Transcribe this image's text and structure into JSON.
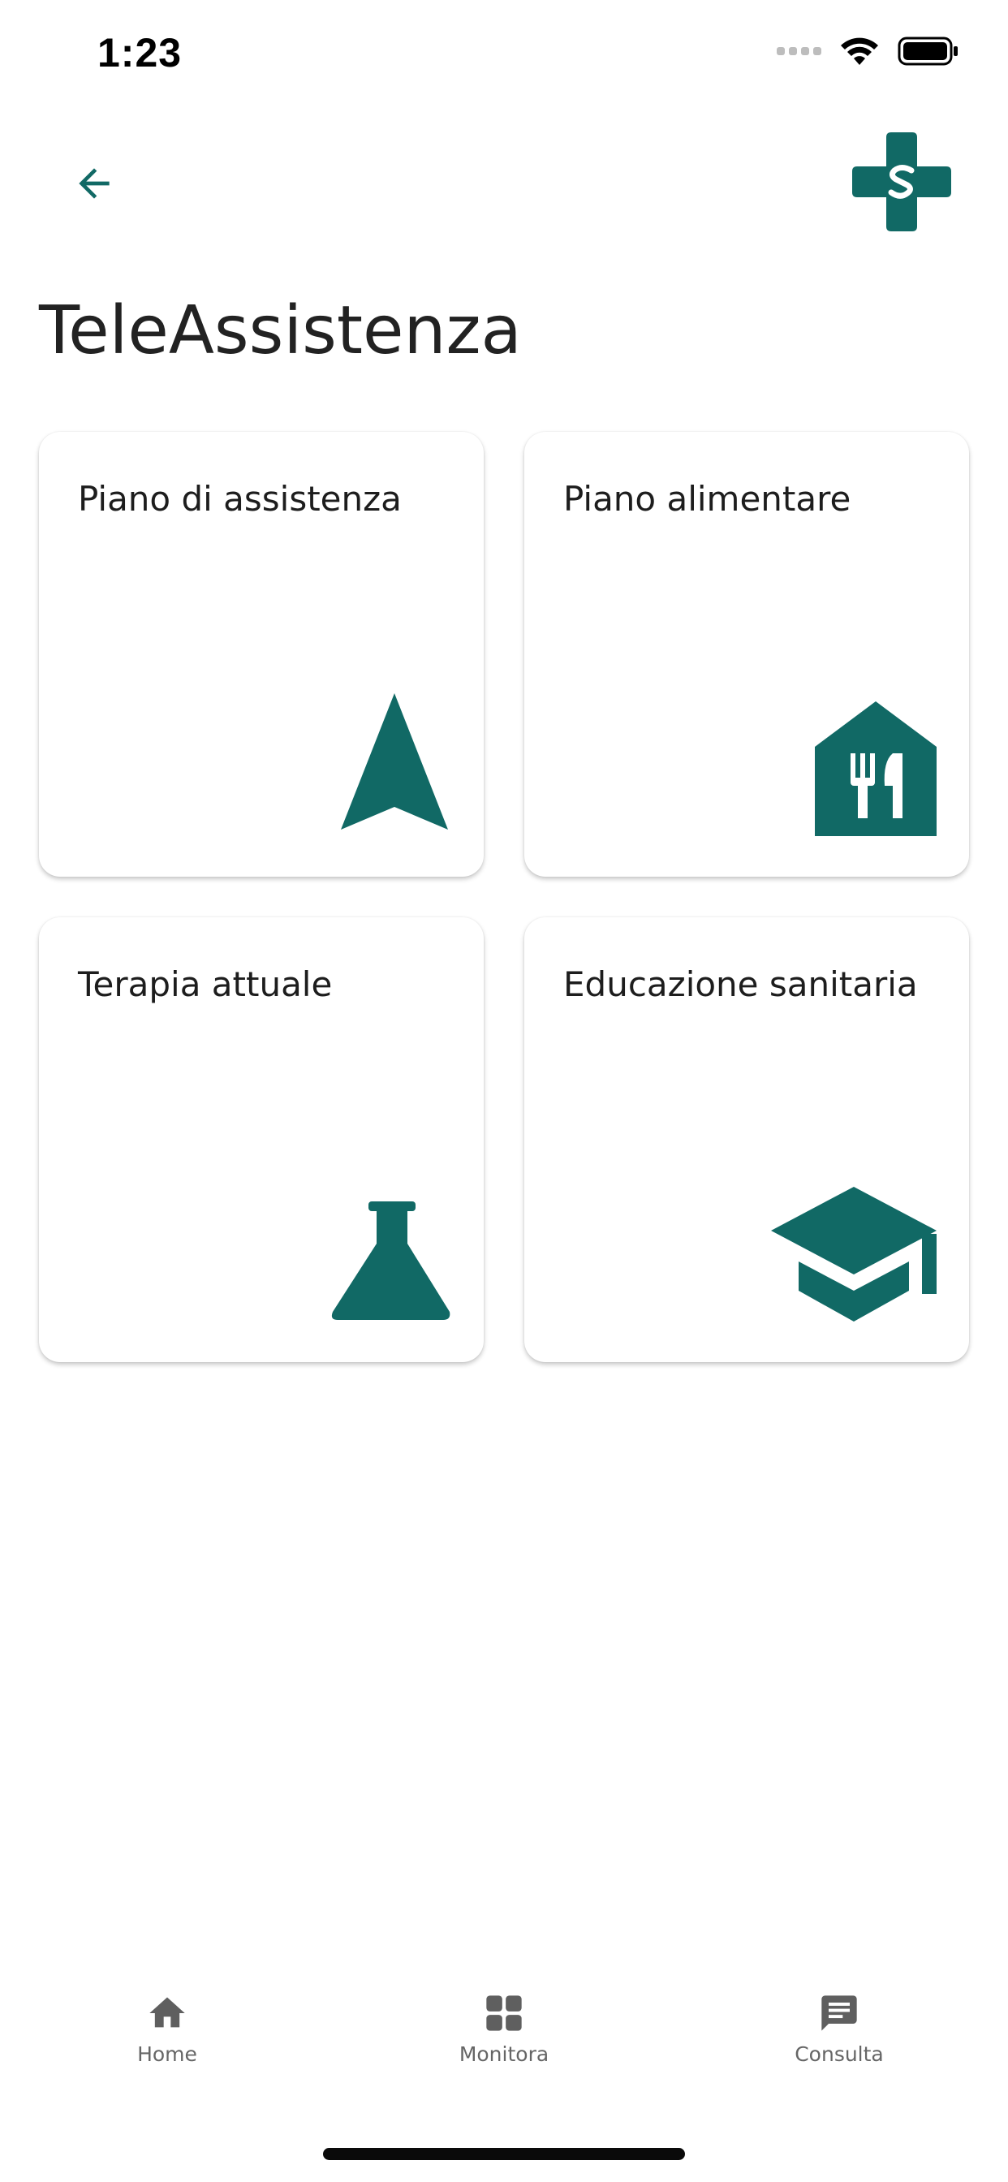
{
  "status_bar": {
    "time": "1:23"
  },
  "header": {
    "title": "TeleAssistenza"
  },
  "cards": [
    {
      "label": "Piano di assistenza",
      "icon": "navigation-arrow-icon"
    },
    {
      "label": "Piano alimentare",
      "icon": "restaurant-house-icon"
    },
    {
      "label": "Terapia attuale",
      "icon": "flask-icon"
    },
    {
      "label": "Educazione sanitaria",
      "icon": "graduation-cap-icon"
    }
  ],
  "bottom_nav": [
    {
      "label": "Home",
      "icon": "home-icon"
    },
    {
      "label": "Monitora",
      "icon": "dashboard-grid-icon"
    },
    {
      "label": "Consulta",
      "icon": "chat-icon"
    }
  ],
  "colors": {
    "accent": "#116965",
    "nav_icon": "#5f5f5f",
    "background": "#ffffff"
  }
}
